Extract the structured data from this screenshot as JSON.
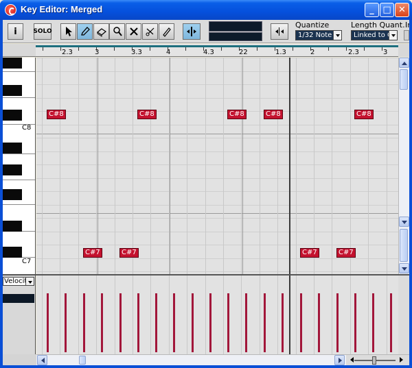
{
  "window": {
    "title": "Key Editor: Merged",
    "minimize": "_",
    "maximize": "□",
    "close": "✕"
  },
  "toolbar": {
    "info_label": "i",
    "solo_label": "SOLO",
    "tools": [
      "arrow-icon",
      "pencil-icon",
      "eraser-icon",
      "zoom-icon",
      "mute-icon",
      "scissors-icon",
      "glue-icon",
      "split-icon",
      "snap-icon"
    ],
    "quantize": {
      "label": "Quantize",
      "value": "1/32 Note"
    },
    "length_quantize": {
      "label": "Length Quant.",
      "value": "Linked to Q"
    },
    "insert_label": "In"
  },
  "ruler": {
    "labels": [
      "2.3",
      "3",
      "3.3",
      "4",
      "4.3",
      "22",
      "1.3",
      "2",
      "2.3",
      "3"
    ]
  },
  "keyboard": {
    "labels": [
      "C8",
      "C7"
    ]
  },
  "notes": [
    {
      "pitch": "C#8",
      "label": "C#8"
    },
    {
      "pitch": "C#8",
      "label": "C#8"
    },
    {
      "pitch": "C#8",
      "label": "C#8"
    },
    {
      "pitch": "C#8",
      "label": "C#8"
    },
    {
      "pitch": "C#8",
      "label": "C#8"
    },
    {
      "pitch": "C#7",
      "label": "C#7"
    },
    {
      "pitch": "C#7",
      "label": "C#7"
    },
    {
      "pitch": "C#7",
      "label": "C#7"
    },
    {
      "pitch": "C#7",
      "label": "C#7"
    }
  ],
  "controller_lane": {
    "selector": "Velocity"
  },
  "colors": {
    "note": "#c4122f",
    "velocity": "#a2163a",
    "grid": "#e2e2e2",
    "title_bar": "#0a5fe8"
  }
}
